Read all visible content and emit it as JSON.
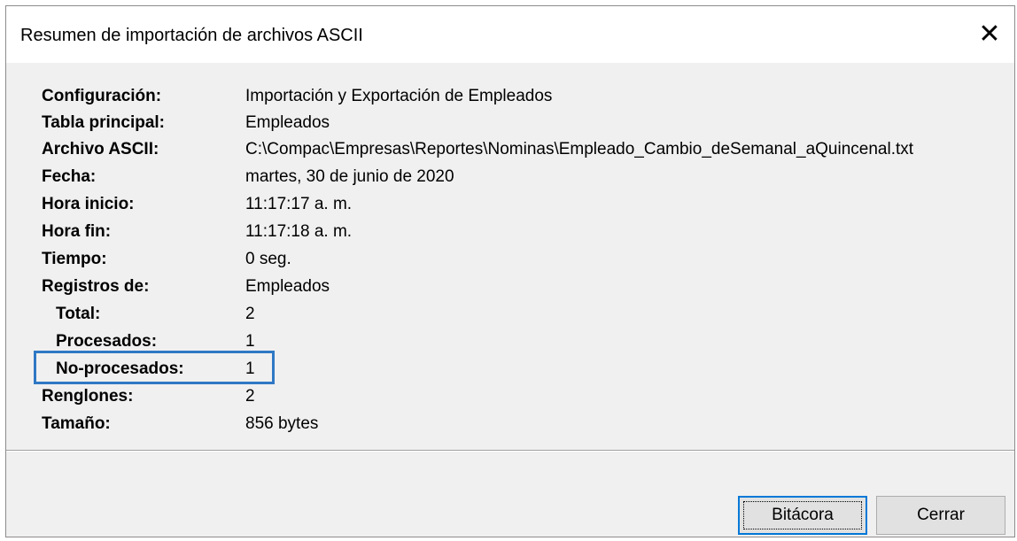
{
  "window": {
    "title": "Resumen de importación de archivos ASCII",
    "close_symbol": "✕"
  },
  "summary": {
    "rows": [
      {
        "label": "Configuración:",
        "value": "Importación y Exportación de Empleados"
      },
      {
        "label": "Tabla principal:",
        "value": "Empleados"
      },
      {
        "label": "Archivo ASCII:",
        "value": "C:\\Compac\\Empresas\\Reportes\\Nominas\\Empleado_Cambio_deSemanal_aQuincenal.txt"
      },
      {
        "label": "Fecha:",
        "value": "martes, 30 de junio de 2020"
      },
      {
        "label": "Hora inicio:",
        "value": "11:17:17 a. m."
      },
      {
        "label": "Hora fin:",
        "value": "11:17:18 a. m."
      },
      {
        "label": "Tiempo:",
        "value": "0 seg."
      },
      {
        "label": "Registros de:",
        "value": "Empleados"
      },
      {
        "label": "Total:",
        "value": "2"
      },
      {
        "label": "Procesados:",
        "value": "1"
      },
      {
        "label": "No-procesados:",
        "value": "1"
      },
      {
        "label": "Renglones:",
        "value": "2"
      },
      {
        "label": "Tamaño:",
        "value": "856 bytes"
      }
    ]
  },
  "buttons": {
    "bitacora": "Bitácora",
    "cerrar": "Cerrar"
  },
  "colors": {
    "highlight": "#2f78c5",
    "default_button_border": "#0078d7"
  }
}
